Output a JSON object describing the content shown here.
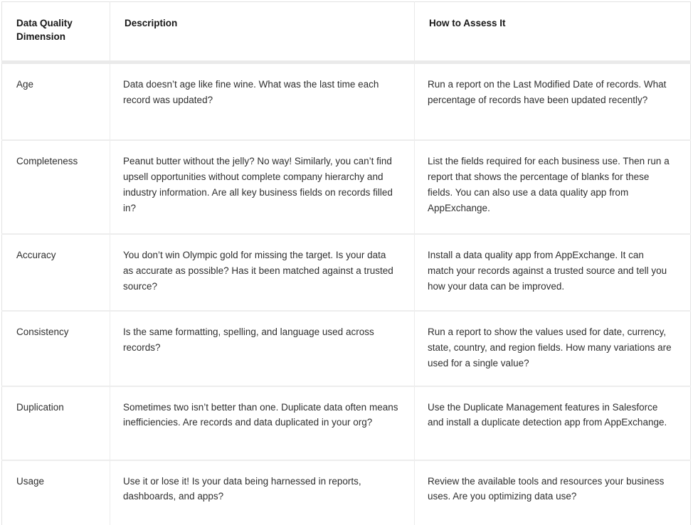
{
  "table": {
    "headers": [
      "Data Quality Dimension",
      "Description",
      "How to Assess It"
    ],
    "rows": [
      {
        "dimension": "Age",
        "description": "Data doesn’t age like fine wine. What was the last time each record was updated?",
        "assess": "Run a report on the Last Modified Date of records. What percentage of records have been updated recently?"
      },
      {
        "dimension": "Completeness",
        "description": "Peanut butter without the jelly? No way! Similarly, you can’t find upsell opportunities without complete company hierarchy and industry information. Are all key business fields on records filled in?",
        "assess": "List the fields required for each business use. Then run a report that shows the percentage of blanks for these fields. You can also use a data quality app from AppExchange."
      },
      {
        "dimension": "Accuracy",
        "description": "You don’t win Olympic gold for missing the target. Is your data as accurate as possible? Has it been matched against a trusted source?",
        "assess": "Install a data quality app from AppExchange. It can match your records against a trusted source and tell you how your data can be improved."
      },
      {
        "dimension": "Consistency",
        "description": "Is the same formatting, spelling, and language used across records?",
        "assess": "Run a report to show the values used for date, currency, state, country, and region fields. How many variations are used for a single value?"
      },
      {
        "dimension": "Duplication",
        "description": "Sometimes two isn’t better than one. Duplicate data often means inefficiencies. Are records and data duplicated in your org?",
        "assess": "Use the Duplicate Management features in Salesforce and install a duplicate detection app from AppExchange."
      },
      {
        "dimension": "Usage",
        "description": "Use it or lose it! Is your data being harnessed in reports, dashboards, and apps?",
        "assess": "Review the available tools and resources your business uses. Are you optimizing data use?"
      }
    ]
  },
  "colors": {
    "text": "#2f2f2f",
    "header_text": "#181818",
    "border": "#ececec",
    "header_rule": "#eaeaea",
    "background": "#ffffff"
  }
}
